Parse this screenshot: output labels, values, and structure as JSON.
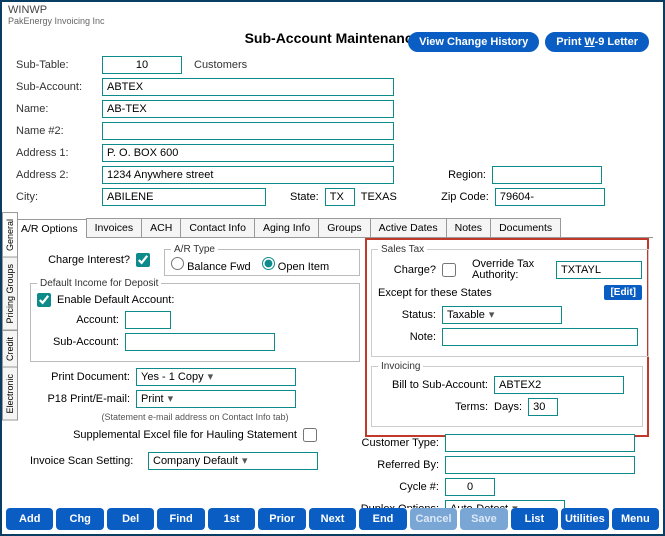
{
  "window": {
    "app": "WINWP",
    "company": "PakEnergy Invoicing Inc",
    "title": "Sub-Account Maintenance"
  },
  "topButtons": {
    "history": "View Change History",
    "w9_pre": "Print ",
    "w9_u": "W",
    "w9_post": "-9 Letter"
  },
  "labels": {
    "subTable": "Sub-Table:",
    "customers": "Customers",
    "subAccount": "Sub-Account:",
    "name": "Name:",
    "name2": "Name #2:",
    "addr1": "Address 1:",
    "addr2": "Address 2:",
    "city": "City:",
    "state": "State:",
    "stateName": "TEXAS",
    "region": "Region:",
    "zip": "Zip Code:"
  },
  "values": {
    "subTable": "10",
    "subAccount": "ABTEX",
    "name": "AB-TEX",
    "name2": "",
    "addr1": "P. O. BOX 600",
    "addr2": "1234 Anywhere street",
    "city": "ABILENE",
    "state": "TX",
    "region": "",
    "zip": "79604-"
  },
  "tabs": {
    "h": [
      "A/R Options",
      "Invoices",
      "ACH",
      "Contact Info",
      "Aging Info",
      "Groups",
      "Active Dates",
      "Notes",
      "Documents"
    ],
    "v": [
      "General",
      "Pricing Groups",
      "Credit",
      "Electronic"
    ]
  },
  "ar": {
    "chargeInterest": "Charge Interest?",
    "arType": "A/R Type",
    "balanceFwd": "Balance Fwd",
    "openItem": "Open Item",
    "defaultIncome": "Default Income for Deposit",
    "enableDefault": "Enable Default Account:",
    "account": "Account:",
    "subAccount": "Sub-Account:",
    "printDoc": "Print Document:",
    "printDocVal": "Yes - 1 Copy",
    "p18": "P18 Print/E-mail:",
    "p18Val": "Print",
    "stmtNote": "(Statement e-mail address on Contact Info tab)",
    "supplemental": "Supplemental Excel file for Hauling Statement",
    "scan": "Invoice Scan Setting:",
    "scanVal": "Company Default",
    "duplex": "Duplex Options:",
    "duplexVal": "Auto-Detect"
  },
  "salesTax": {
    "legend": "Sales Tax",
    "charge": "Charge?",
    "override": "Override  Tax Authority:",
    "overrideVal": "TXTAYL",
    "except": "Except for these States",
    "edit": "[Edit]",
    "status": "Status:",
    "statusVal": "Taxable",
    "note": "Note:",
    "noteVal": ""
  },
  "invoicing": {
    "legend": "Invoicing",
    "billTo": "Bill to Sub-Account:",
    "billToVal": "ABTEX2",
    "terms": "Terms:",
    "days": "Days:",
    "daysVal": "30"
  },
  "misc": {
    "custType": "Customer Type:",
    "custTypeVal": "",
    "refBy": "Referred By:",
    "refByVal": "",
    "cycle": "Cycle #:",
    "cycleVal": "0"
  },
  "footer": [
    "Add",
    "Chg",
    "Del",
    "Find",
    "1st",
    "Prior",
    "Next",
    "End",
    "Cancel",
    "Save",
    "List",
    "Utilities",
    "Menu"
  ],
  "footerDisabled": [
    "Cancel",
    "Save"
  ]
}
